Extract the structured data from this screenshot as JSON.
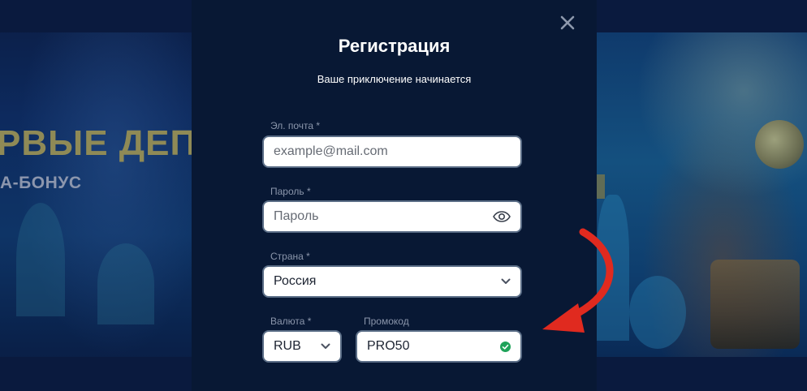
{
  "background": {
    "promo_line1": "РВЫЕ ДЕП",
    "promo_line2": "А-БОНУС"
  },
  "modal": {
    "title": "Регистрация",
    "subtitle": "Ваше приключение начинается",
    "close_icon": "close-icon",
    "fields": {
      "email": {
        "label": "Эл. почта *",
        "placeholder": "example@mail.com"
      },
      "password": {
        "label": "Пароль *",
        "placeholder": "Пароль",
        "icon": "eye-icon"
      },
      "country": {
        "label": "Страна *",
        "value": "Россия",
        "icon": "chevron-down-icon"
      },
      "currency": {
        "label": "Валюта *",
        "value": "RUB",
        "icon": "chevron-down-icon"
      },
      "promo": {
        "label": "Промокод",
        "value": "PRO50",
        "icon": "check-circle-icon"
      }
    }
  },
  "colors": {
    "modal_bg": "#081834",
    "field_border": "#5a6d86",
    "label": "#8b96ab",
    "success": "#1fa35a",
    "arrow": "#e02a1f"
  }
}
